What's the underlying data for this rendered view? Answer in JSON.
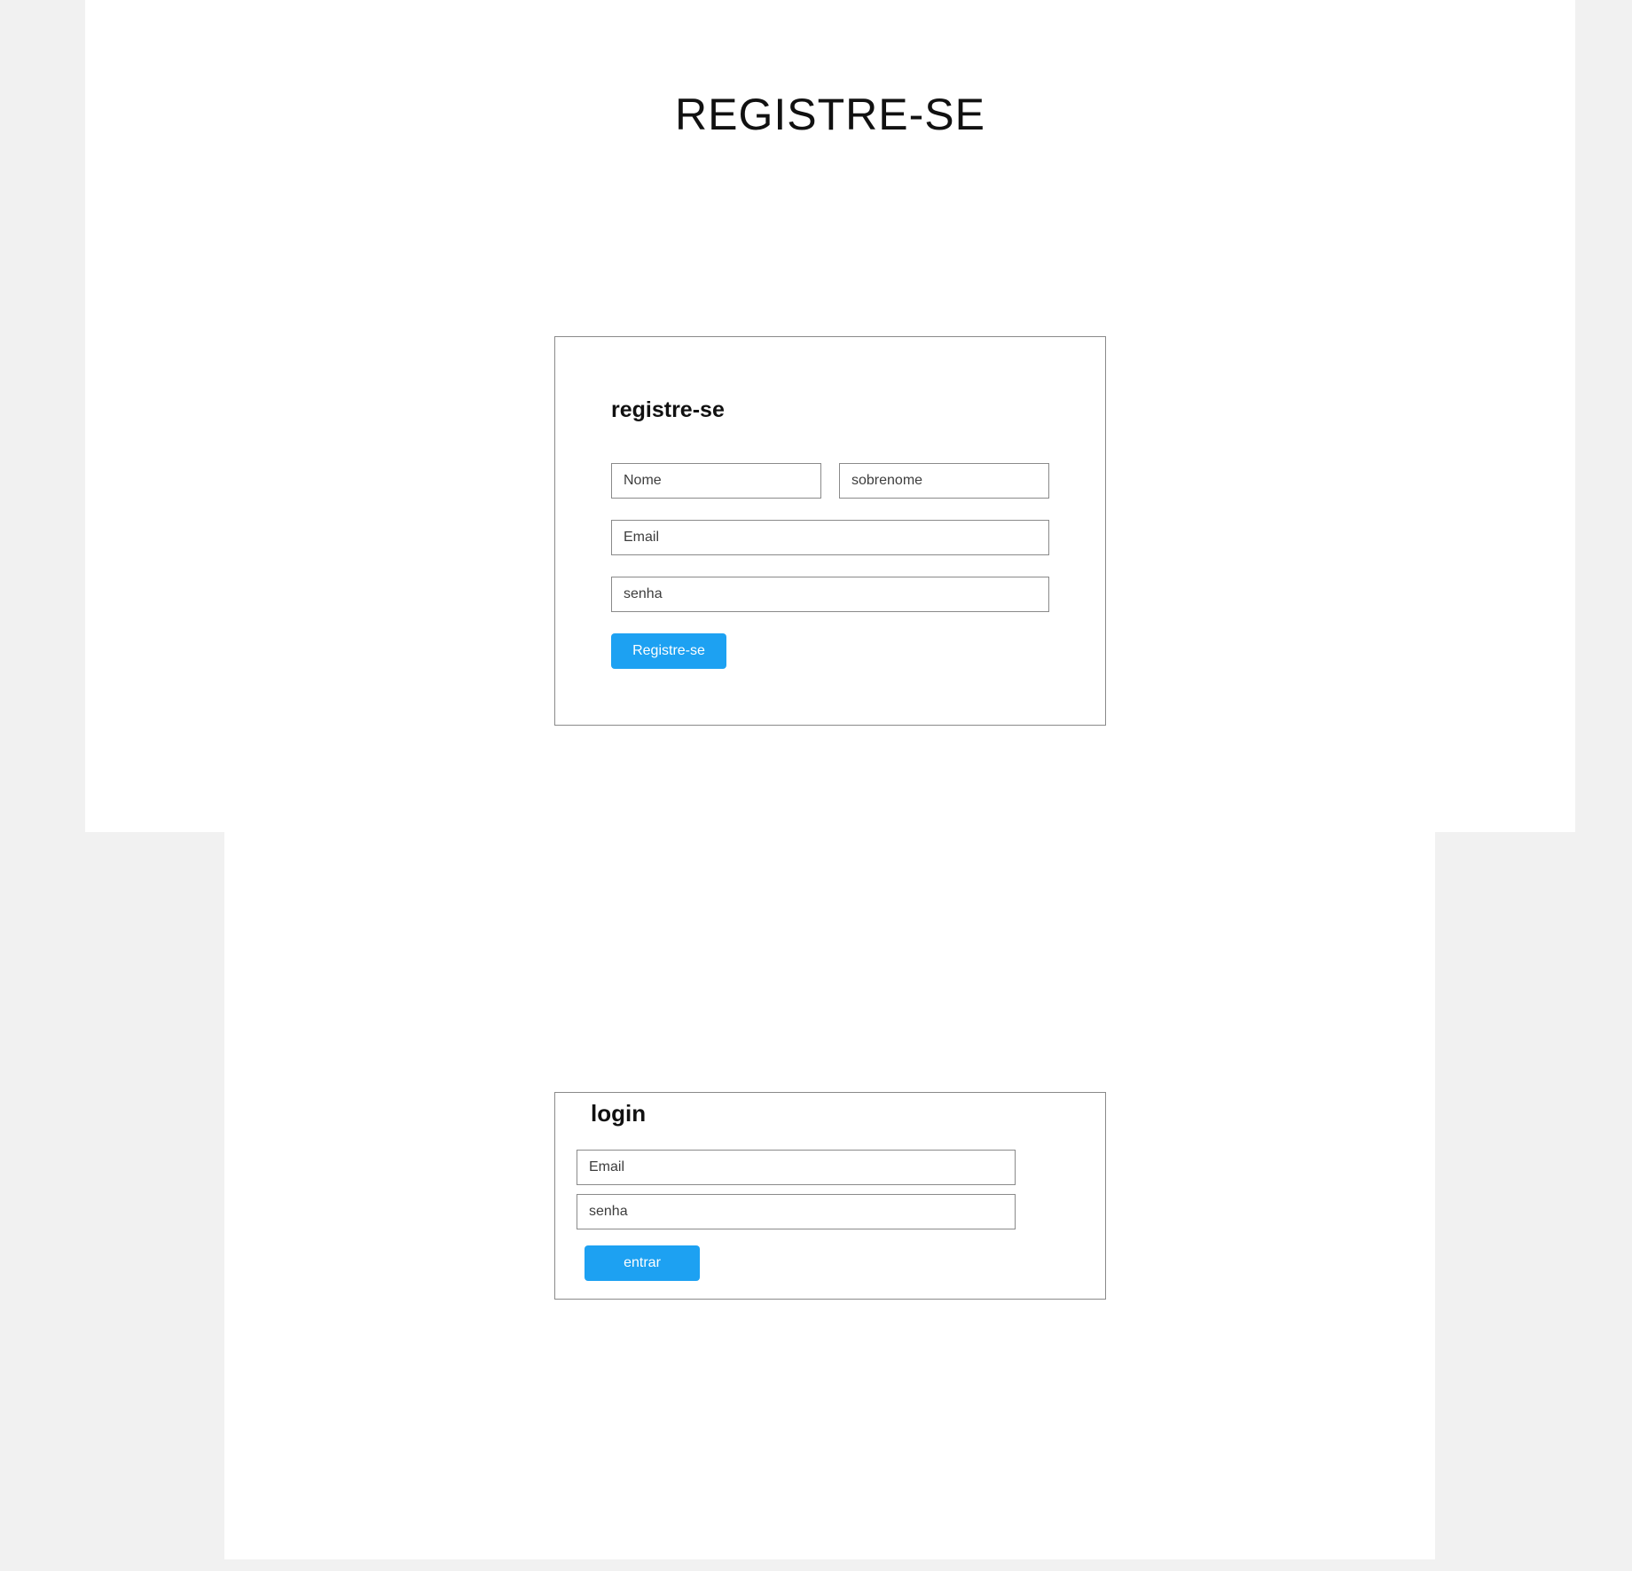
{
  "page": {
    "title": "REGISTRE-SE",
    "background_color": "#f1f1f1",
    "panel_color": "#ffffff"
  },
  "register": {
    "heading": "registre-se",
    "first_name_placeholder": "Nome",
    "last_name_placeholder": "sobrenome",
    "email_placeholder": "Email",
    "password_placeholder": "senha",
    "submit_label": "Registre-se"
  },
  "login": {
    "heading": "login",
    "email_placeholder": "Email",
    "password_placeholder": "senha",
    "submit_label": "entrar"
  },
  "colors": {
    "accent": "#1da1f2",
    "border": "#8a8a8a",
    "text": "#111111"
  }
}
